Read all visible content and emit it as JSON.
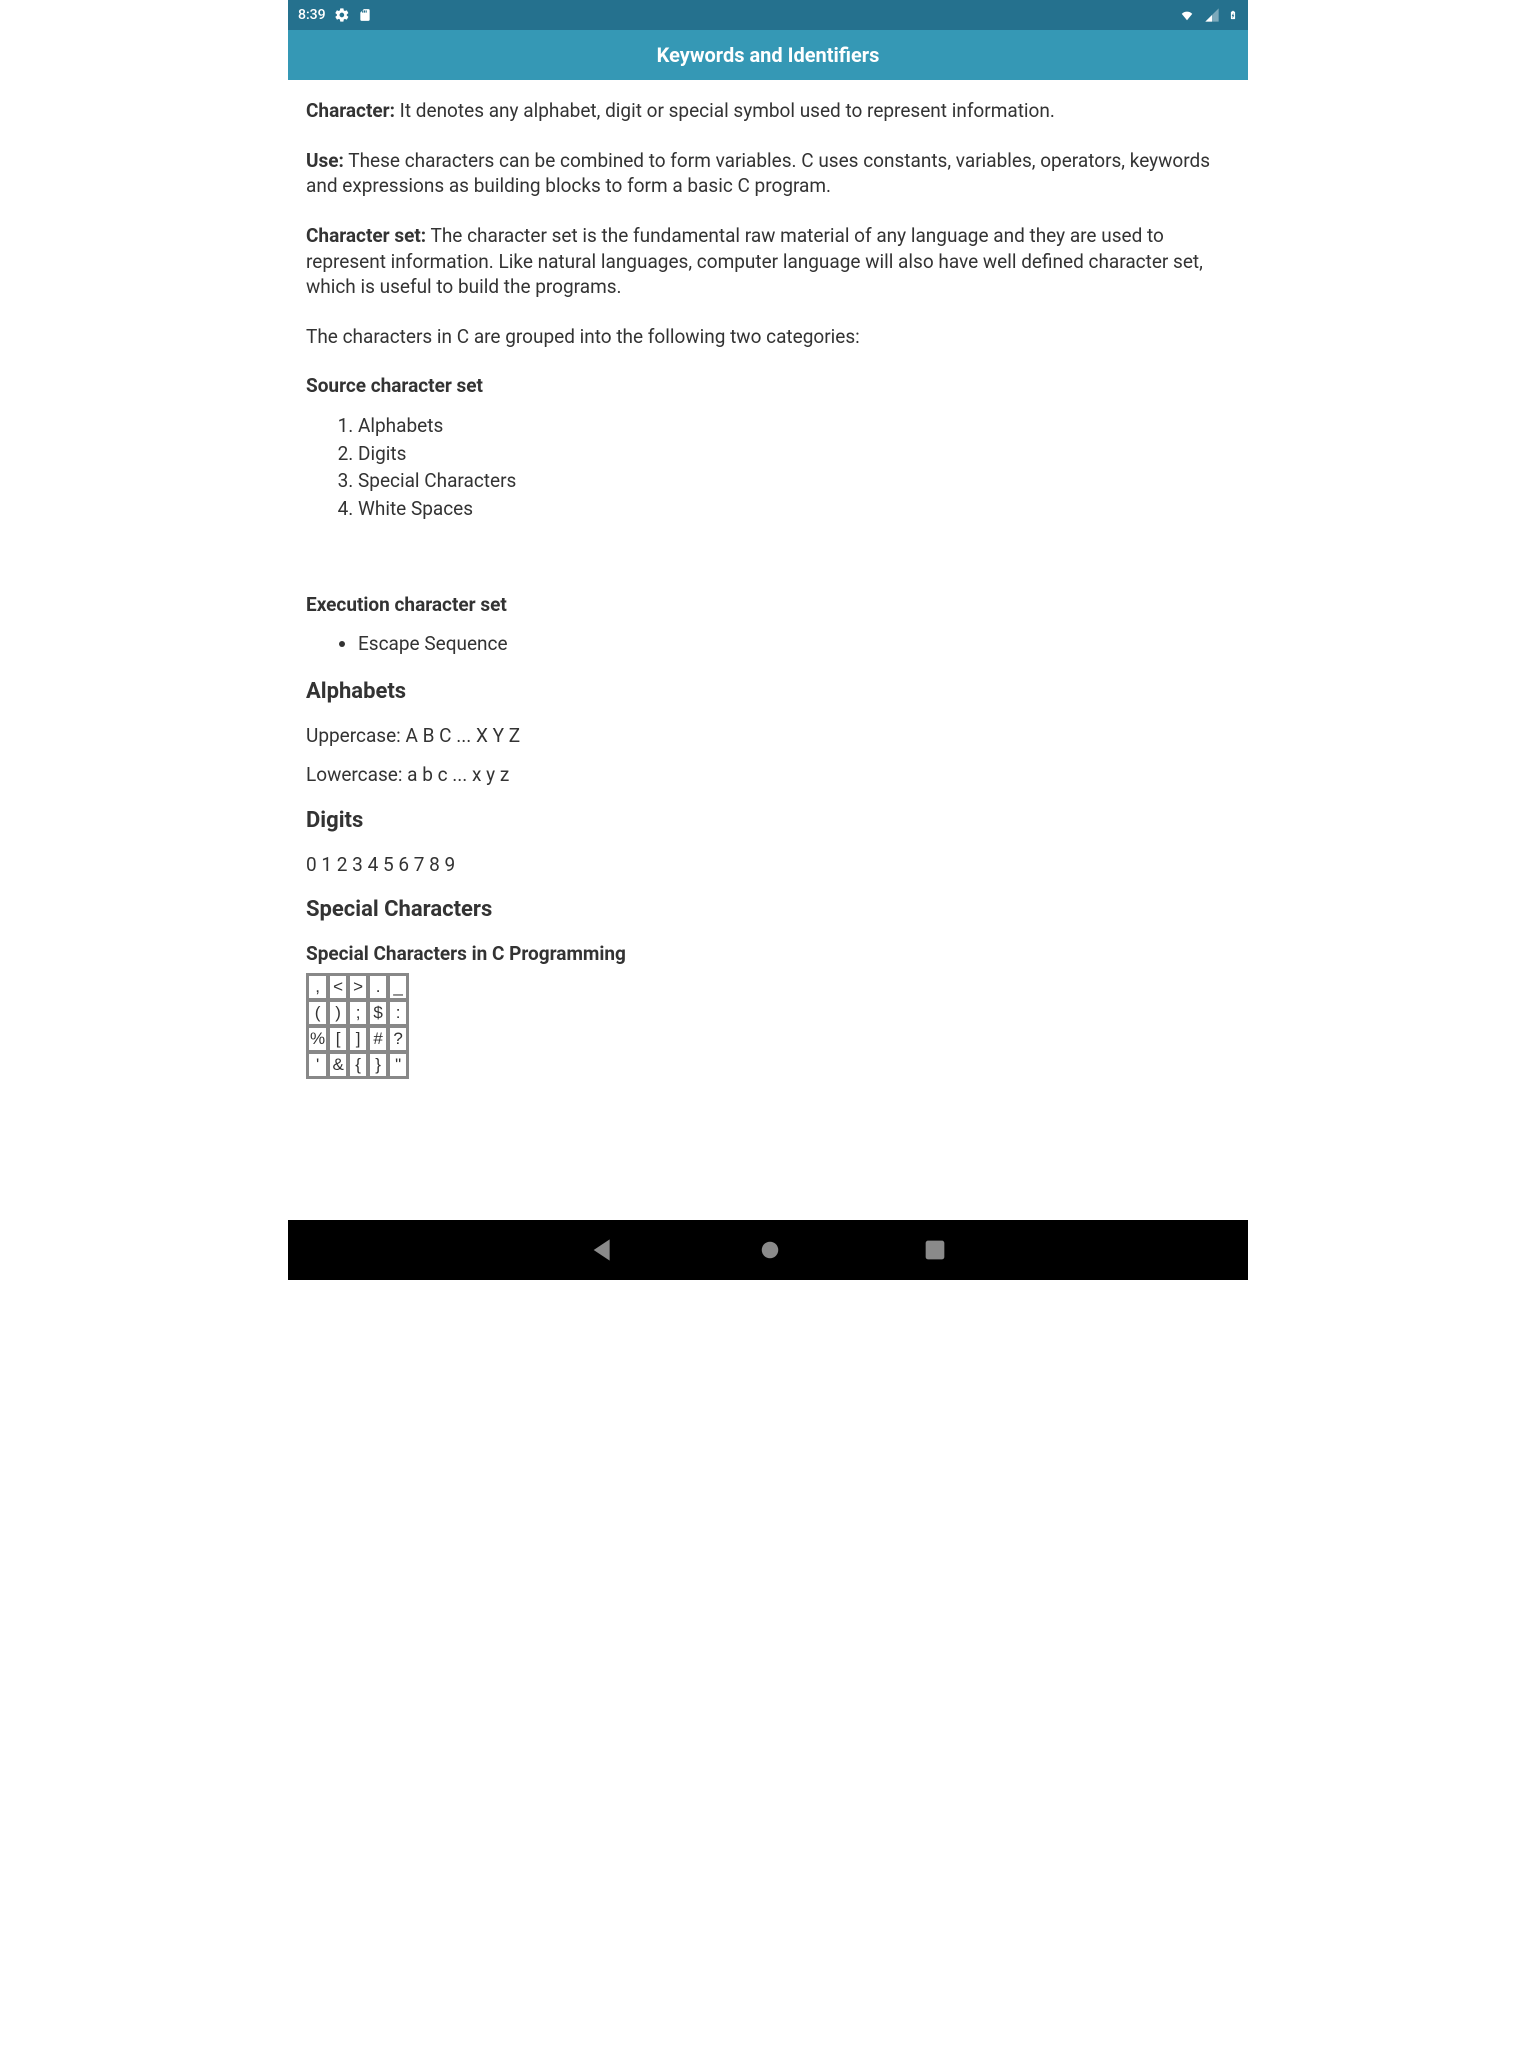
{
  "statusbar": {
    "time": "8:39"
  },
  "appbar": {
    "title": "Keywords and Identifiers"
  },
  "content": {
    "character_label": "Character:",
    "character_text": " It denotes any alphabet, digit or special symbol used to represent information.",
    "use_label": "Use:",
    "use_text": " These characters can be combined to form variables. C uses constants, variables, operators, keywords and expressions as building blocks to form a basic C program.",
    "charset_label": "Character set:",
    "charset_text": "   The character set is the fundamental raw material of any language and they are used to represent information. Like natural languages, computer  language will also have well defined character set, which is useful to build the programs.",
    "grouped_text": "The characters in C are grouped into the following two categories:",
    "source_heading": "Source character set",
    "source_items": {
      "0": "Alphabets",
      "1": "Digits",
      "2": "Special Characters",
      "3": "White Spaces"
    },
    "exec_heading": "Execution character set",
    "exec_items": {
      "0": "Escape Sequence"
    },
    "alphabets_heading": "Alphabets",
    "uppercase_line": "Uppercase: A B C ... X Y Z",
    "lowercase_line": "Lowercase: a b c ... x y z",
    "digits_heading": "Digits",
    "digits_line": "0 1 2 3 4 5 6 7 8 9",
    "special_heading": "Special Characters",
    "table_caption": "Special Characters in C Programming",
    "table": {
      "r0": {
        "c0": ",",
        "c1": "<",
        "c2": ">",
        "c3": ".",
        "c4": "_"
      },
      "r1": {
        "c0": "(",
        "c1": ")",
        "c2": ";",
        "c3": "$",
        "c4": ":"
      },
      "r2": {
        "c0": "%",
        "c1": "[",
        "c2": "]",
        "c3": "#",
        "c4": "?"
      },
      "r3": {
        "c0": "'",
        "c1": "&",
        "c2": "{",
        "c3": "}",
        "c4": "\""
      }
    }
  }
}
